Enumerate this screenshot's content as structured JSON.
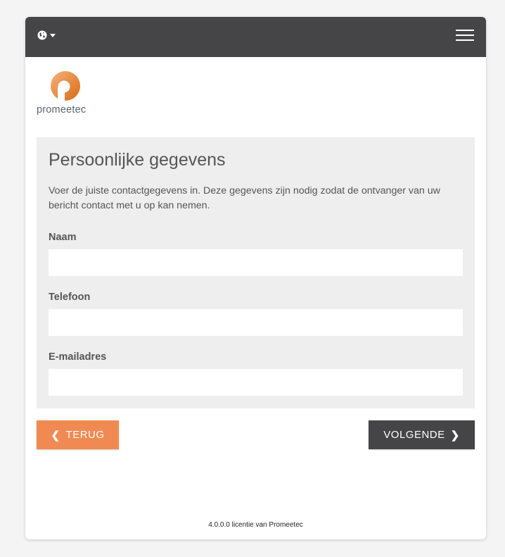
{
  "header": {
    "language_icon": "globe-icon",
    "dropdown_icon": "caret-down-icon",
    "menu_icon": "hamburger-menu-icon"
  },
  "logo": {
    "text": "promeetec"
  },
  "form": {
    "title": "Persoonlijke gegevens",
    "description": "Voer de juiste contactgegevens in. Deze gegevens zijn nodig zodat de ontvanger van uw bericht contact met u op kan nemen.",
    "fields": [
      {
        "label": "Naam",
        "value": ""
      },
      {
        "label": "Telefoon",
        "value": ""
      },
      {
        "label": "E-mailadres",
        "value": ""
      }
    ]
  },
  "buttons": {
    "back_label": "TERUG",
    "next_label": "VOLGENDE"
  },
  "footer": {
    "text": "4.0.0.0 licentie van Promeetec"
  },
  "colors": {
    "topbar": "#454547",
    "accent": "#f08a52",
    "panel": "#eeeeee"
  }
}
